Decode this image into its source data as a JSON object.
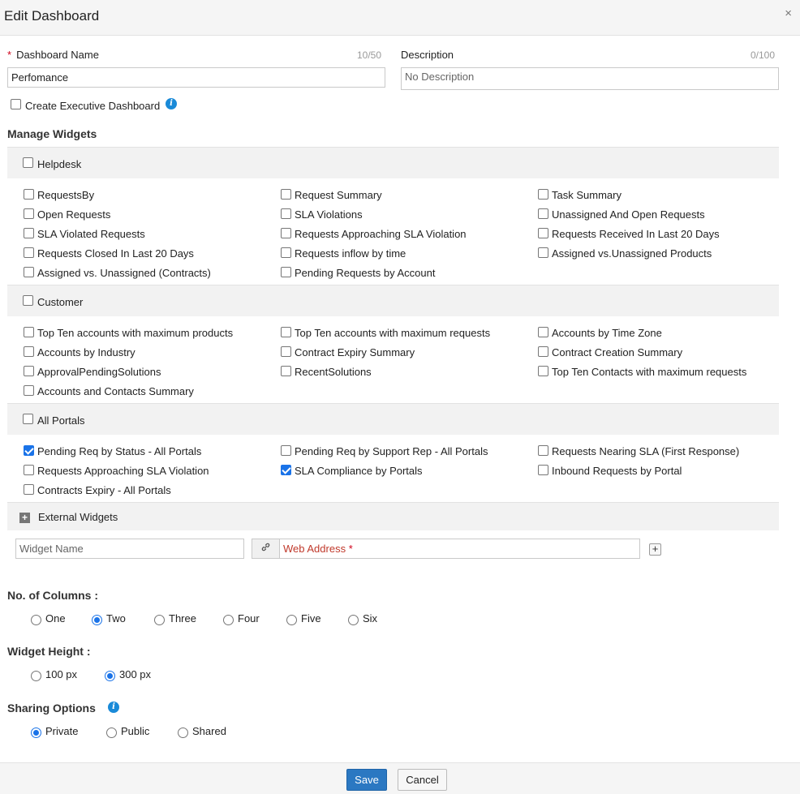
{
  "dialog": {
    "title": "Edit Dashboard",
    "close_glyph": "×"
  },
  "form": {
    "name_label": "Dashboard Name",
    "name_counter": "10/50",
    "name_value": "Perfomance",
    "desc_label": "Description",
    "desc_counter": "0/100",
    "desc_placeholder": "No Description",
    "executive_label": "Create Executive Dashboard"
  },
  "widgets": {
    "title": "Manage Widgets",
    "groups": [
      {
        "name": "Helpdesk",
        "checked": false,
        "items": [
          {
            "label": "RequestsBy",
            "checked": false
          },
          {
            "label": "Request Summary",
            "checked": false
          },
          {
            "label": "Task Summary",
            "checked": false
          },
          {
            "label": "Open Requests",
            "checked": false
          },
          {
            "label": "SLA Violations",
            "checked": false
          },
          {
            "label": "Unassigned And Open Requests",
            "checked": false
          },
          {
            "label": "SLA Violated Requests",
            "checked": false
          },
          {
            "label": "Requests Approaching SLA Violation",
            "checked": false
          },
          {
            "label": "Requests Received In Last 20 Days",
            "checked": false
          },
          {
            "label": "Requests Closed In Last 20 Days",
            "checked": false
          },
          {
            "label": "Requests inflow by time",
            "checked": false
          },
          {
            "label": "Assigned vs.Unassigned Products",
            "checked": false
          },
          {
            "label": "Assigned vs. Unassigned (Contracts)",
            "checked": false
          },
          {
            "label": "Pending Requests by Account",
            "checked": false
          }
        ]
      },
      {
        "name": "Customer",
        "checked": false,
        "items": [
          {
            "label": "Top Ten accounts with maximum products",
            "checked": false
          },
          {
            "label": "Top Ten accounts with maximum requests",
            "checked": false
          },
          {
            "label": "Accounts by Time Zone",
            "checked": false
          },
          {
            "label": "Accounts by Industry",
            "checked": false
          },
          {
            "label": "Contract Expiry Summary",
            "checked": false
          },
          {
            "label": "Contract Creation Summary",
            "checked": false
          },
          {
            "label": "ApprovalPendingSolutions",
            "checked": false
          },
          {
            "label": "RecentSolutions",
            "checked": false
          },
          {
            "label": "Top Ten Contacts with maximum requests",
            "checked": false
          },
          {
            "label": "Accounts and Contacts Summary",
            "checked": false
          }
        ]
      },
      {
        "name": "All Portals",
        "checked": false,
        "items": [
          {
            "label": "Pending Req by Status - All Portals",
            "checked": true
          },
          {
            "label": "Pending Req by Support Rep - All Portals",
            "checked": false
          },
          {
            "label": "Requests Nearing SLA (First Response)",
            "checked": false
          },
          {
            "label": "Requests Approaching SLA Violation",
            "checked": false
          },
          {
            "label": "SLA Compliance by Portals",
            "checked": true
          },
          {
            "label": "Inbound Requests by Portal",
            "checked": false
          },
          {
            "label": "Contracts Expiry - All Portals",
            "checked": false
          }
        ]
      }
    ],
    "external": {
      "label": "External Widgets",
      "name_placeholder": "Widget Name",
      "web_address_label": "Web Address",
      "required_mark": "*",
      "link_icon": "link-icon",
      "add_glyph": "+"
    }
  },
  "columns": {
    "title": "No. of Columns :",
    "options": [
      "One",
      "Two",
      "Three",
      "Four",
      "Five",
      "Six"
    ],
    "selected": "Two"
  },
  "height": {
    "title": "Widget Height :",
    "options": [
      "100 px",
      "300 px"
    ],
    "selected": "300 px"
  },
  "sharing": {
    "title": "Sharing Options",
    "options": [
      "Private",
      "Public",
      "Shared"
    ],
    "selected": "Private"
  },
  "footer": {
    "save_label": "Save",
    "cancel_label": "Cancel"
  },
  "colors": {
    "primary": "#2b78c2",
    "check": "#1a73e8",
    "info": "#1a8ad8",
    "required": "#d0021b"
  }
}
